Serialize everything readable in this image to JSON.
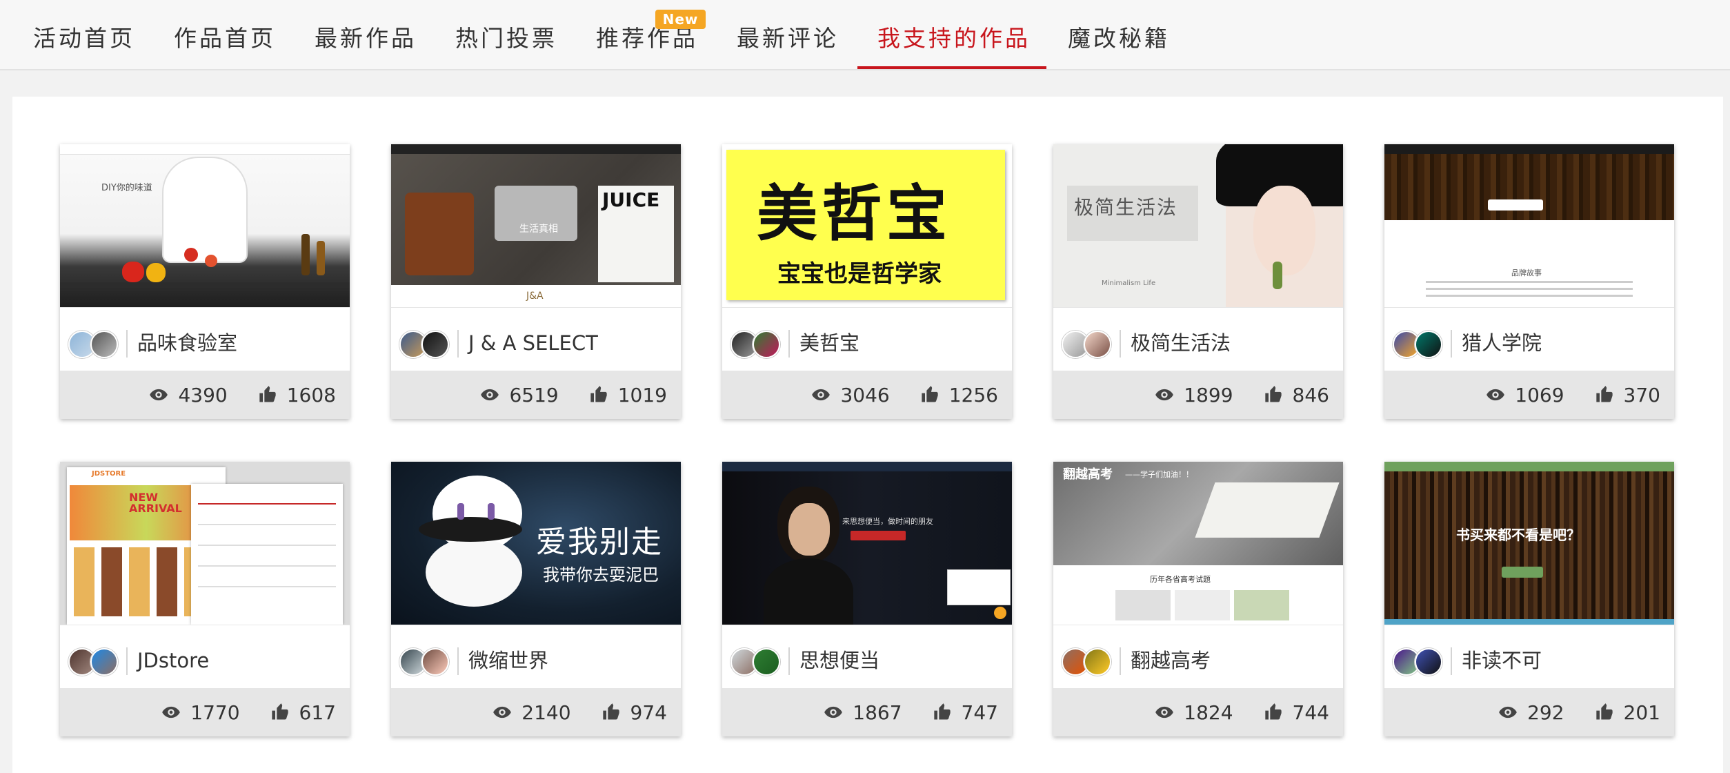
{
  "nav": {
    "items": [
      {
        "label": "活动首页"
      },
      {
        "label": "作品首页"
      },
      {
        "label": "最新作品"
      },
      {
        "label": "热门投票"
      },
      {
        "label": "推荐作品"
      },
      {
        "label": "最新评论"
      },
      {
        "label": "我支持的作品"
      },
      {
        "label": "魔改秘籍"
      }
    ],
    "badge": "New",
    "active_index": 6
  },
  "colors": {
    "accent": "#c8161d",
    "badge": "#f5a623",
    "stats_bg": "#e6e6e6"
  },
  "cards": [
    {
      "title": "品味食验室",
      "views": "4390",
      "likes": "1608",
      "thumb": {
        "line1": "DIY你的味道"
      }
    },
    {
      "title": "J & A SELECT",
      "views": "6519",
      "likes": "1019",
      "thumb": {
        "big": "JUICE",
        "line1": "生活真相",
        "line2": "J&A"
      }
    },
    {
      "title": "美哲宝",
      "views": "3046",
      "likes": "1256",
      "thumb": {
        "big": "美哲宝",
        "line1": "宝宝也是哲学家"
      }
    },
    {
      "title": "极简生活法",
      "views": "1899",
      "likes": "846",
      "thumb": {
        "big": "极简生活法",
        "line2": "Minimalism Life"
      }
    },
    {
      "title": "猎人学院",
      "views": "1069",
      "likes": "370",
      "thumb": {
        "line1": "品牌故事"
      }
    },
    {
      "title": "JDstore",
      "views": "1770",
      "likes": "617",
      "thumb": {
        "big": "NEW ARRIVAL",
        "line1": "JDSTORE"
      }
    },
    {
      "title": "微缩世界",
      "views": "2140",
      "likes": "974",
      "thumb": {
        "big": "爱我别走",
        "line1": "我带你去耍泥巴"
      }
    },
    {
      "title": "思想便当",
      "views": "1867",
      "likes": "747",
      "thumb": {
        "line1": "来思想便当，做时间的朋友"
      }
    },
    {
      "title": "翻越高考",
      "views": "1824",
      "likes": "744",
      "thumb": {
        "big": "翻越高考",
        "line1": "——学子们加油！！",
        "line2": "历年各省高考试题"
      }
    },
    {
      "title": "非读不可",
      "views": "292",
      "likes": "201",
      "thumb": {
        "line1": "书买来都不看是吧？"
      }
    }
  ]
}
